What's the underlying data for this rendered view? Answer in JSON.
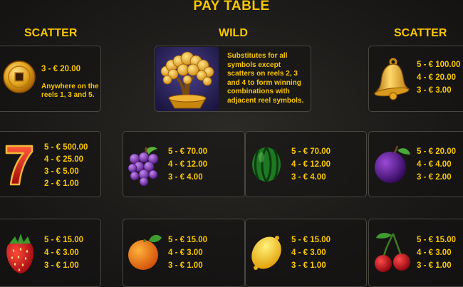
{
  "title": "PAY TABLE",
  "headings": {
    "scatter_left": "SCATTER",
    "wild": "WILD",
    "scatter_right": "SCATTER"
  },
  "coin_scatter": {
    "icon": "coin-icon",
    "pays": [
      "3 - € 20.00"
    ],
    "note": [
      "Anywhere on the",
      "reels 1, 3 and 5."
    ]
  },
  "wild": {
    "icon": "money-tree-icon",
    "text": [
      "Substitutes for all",
      "symbols except",
      "scatters on reels 2, 3",
      "and 4 to form winning",
      "combinations with",
      "adjacent reel symbols."
    ]
  },
  "bell_scatter": {
    "icon": "bell-icon",
    "pays": [
      "5 - € 100.00",
      "4 - € 20.00",
      "3 - € 3.00"
    ]
  },
  "seven": {
    "icon": "seven-icon",
    "pays": [
      "5 - € 500.00",
      "4 - € 25.00",
      "3 - € 5.00",
      "2 - € 1.00"
    ]
  },
  "grapes": {
    "icon": "grapes-icon",
    "pays": [
      "5 - € 70.00",
      "4 - € 12.00",
      "3 - € 4.00"
    ]
  },
  "watermelon": {
    "icon": "watermelon-icon",
    "pays": [
      "5 - € 70.00",
      "4 - € 12.00",
      "3 - € 4.00"
    ]
  },
  "plum": {
    "icon": "plum-icon",
    "pays": [
      "5 - € 20.00",
      "4 - € 4.00",
      "3 - € 2.00"
    ]
  },
  "strawberry": {
    "icon": "strawberry-icon",
    "pays": [
      "5 - € 15.00",
      "4 - € 3.00",
      "3 - € 1.00"
    ]
  },
  "orange": {
    "icon": "orange-icon",
    "pays": [
      "5 - € 15.00",
      "4 - € 3.00",
      "3 - € 1.00"
    ]
  },
  "lemon": {
    "icon": "lemon-icon",
    "pays": [
      "5 - € 15.00",
      "4 - € 3.00",
      "3 - € 1.00"
    ]
  },
  "cherries": {
    "icon": "cherries-icon",
    "pays": [
      "5 - € 15.00",
      "4 - € 3.00",
      "3 - € 1.00"
    ]
  },
  "colors": {
    "gold": "#f7c600",
    "border": "#4a4740",
    "background": "#1c1b19"
  }
}
